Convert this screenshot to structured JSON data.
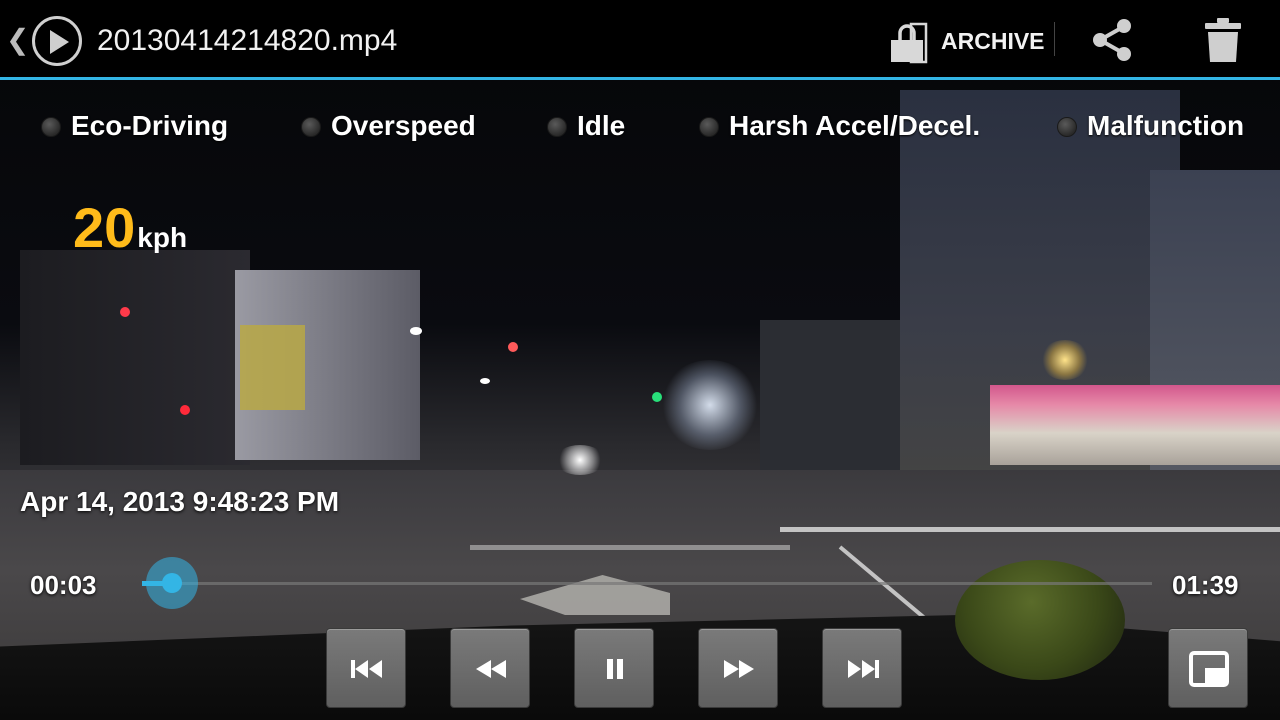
{
  "topbar": {
    "back_icon": "chevron-left-icon",
    "play_icon": "play-circle-icon",
    "file_name": "20130414214820.mp4",
    "archive_label": "ARCHIVE",
    "archive_icon": "lock-icon",
    "share_icon": "share-icon",
    "delete_icon": "trash-icon",
    "accent_color": "#33b5e5"
  },
  "events": [
    {
      "label": "Eco-Driving",
      "active": false
    },
    {
      "label": "Overspeed",
      "active": false
    },
    {
      "label": "Idle",
      "active": false
    },
    {
      "label": "Harsh Accel/Decel.",
      "active": false
    },
    {
      "label": "Malfunction",
      "active": false
    }
  ],
  "speed": {
    "value": "20",
    "unit": "kph",
    "color": "#ffbb1a"
  },
  "timestamp": "Apr 14, 2013 9:48:23 PM",
  "playback": {
    "current_time": "00:03",
    "total_time": "01:39",
    "progress_fraction": 0.03
  },
  "controls": [
    {
      "name": "skip-previous-icon"
    },
    {
      "name": "rewind-icon"
    },
    {
      "name": "pause-icon"
    },
    {
      "name": "fast-forward-icon"
    },
    {
      "name": "skip-next-icon"
    },
    {
      "name": "picture-in-picture-icon"
    }
  ]
}
